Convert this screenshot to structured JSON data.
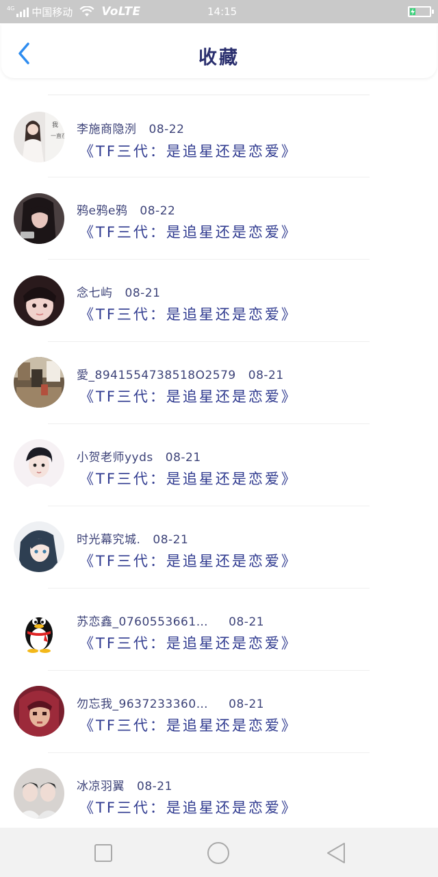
{
  "status_bar": {
    "network": "4G",
    "carrier": "中国移动",
    "volte": "VoLTE",
    "time": "14:15",
    "battery_color": "#3ad17a"
  },
  "header": {
    "title": "收藏",
    "back_icon": "chevron-left-icon",
    "accent": "#2d8cf0"
  },
  "favorites": [
    {
      "sender": "李施商隐洌",
      "date": "08-22",
      "title": "《TF三代：是追星还是恋爱》",
      "avatar": "girl-portrait"
    },
    {
      "sender": "鸦e鸦e鸦",
      "date": "08-22",
      "title": "《TF三代：是追星还是恋爱》",
      "avatar": "dark-hair-girl"
    },
    {
      "sender": "念七屿",
      "date": "08-21",
      "title": "《TF三代：是追星还是恋爱》",
      "avatar": "girl-closeup"
    },
    {
      "sender": "愛_8941554738518O2579",
      "date": "08-21",
      "title": "《TF三代：是追星还是恋爱》",
      "avatar": "room-scene"
    },
    {
      "sender": "小贺老师yyds",
      "date": "08-21",
      "title": "《TF三代：是追星还是恋爱》",
      "avatar": "boy-portrait"
    },
    {
      "sender": "时光幕究城.",
      "date": "08-21",
      "title": "《TF三代：是追星还是恋爱》",
      "avatar": "anime-girl"
    },
    {
      "sender": "苏恋鑫_0760553661…",
      "date": "08-21",
      "title": "《TF三代：是追星还是恋爱》",
      "avatar": "qq-penguin"
    },
    {
      "sender": "勿忘我_9637233360…",
      "date": "08-21",
      "title": "《TF三代：是追星还是恋爱》",
      "avatar": "pixel-character"
    },
    {
      "sender": "冰凉羽翼",
      "date": "08-21",
      "title": "《TF三代：是追星还是恋爱》",
      "avatar": "two-boys-photo"
    }
  ],
  "system_nav": {
    "recent_icon": "square-icon",
    "home_icon": "circle-icon",
    "back_icon": "triangle-back-icon"
  }
}
